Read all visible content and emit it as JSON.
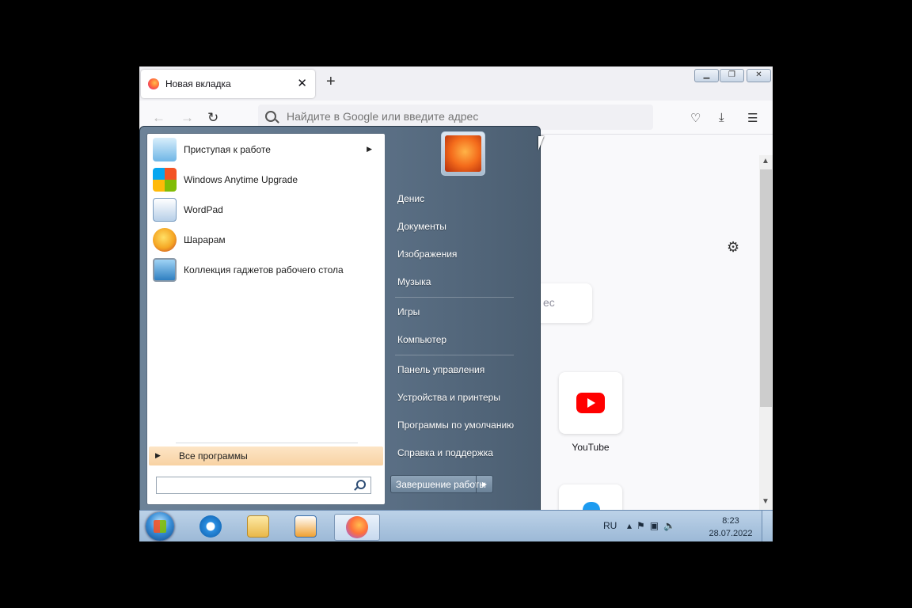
{
  "browser": {
    "tab_title": "Новая вкладка",
    "url_placeholder": "Найдите в Google или введите адрес",
    "search_partial": "ес",
    "top_sites": [
      {
        "label": "YouTube"
      }
    ]
  },
  "start_menu": {
    "programs": [
      {
        "label": "Приступая к работе",
        "icon": "getting-started-icon",
        "has_submenu": true
      },
      {
        "label": "Windows Anytime Upgrade",
        "icon": "windows-flag-icon"
      },
      {
        "label": "WordPad",
        "icon": "wordpad-icon"
      },
      {
        "label": "Шарарам",
        "icon": "shararam-icon"
      },
      {
        "label": "Коллекция гаджетов рабочего стола",
        "icon": "gadgets-icon"
      }
    ],
    "all_programs": "Все программы",
    "right_items": [
      "Денис",
      "Документы",
      "Изображения",
      "Музыка",
      "Игры",
      "Компьютер",
      "Панель управления",
      "Устройства и принтеры",
      "Программы по умолчанию",
      "Справка и поддержка"
    ],
    "shutdown": "Завершение работы"
  },
  "taskbar": {
    "language": "RU",
    "time": "8:23",
    "date": "28.07.2022"
  },
  "colors": {
    "youtube_red": "#ff0000",
    "start_menu": "#5d7288",
    "all_programs_highlight": "#f8d2a3"
  }
}
